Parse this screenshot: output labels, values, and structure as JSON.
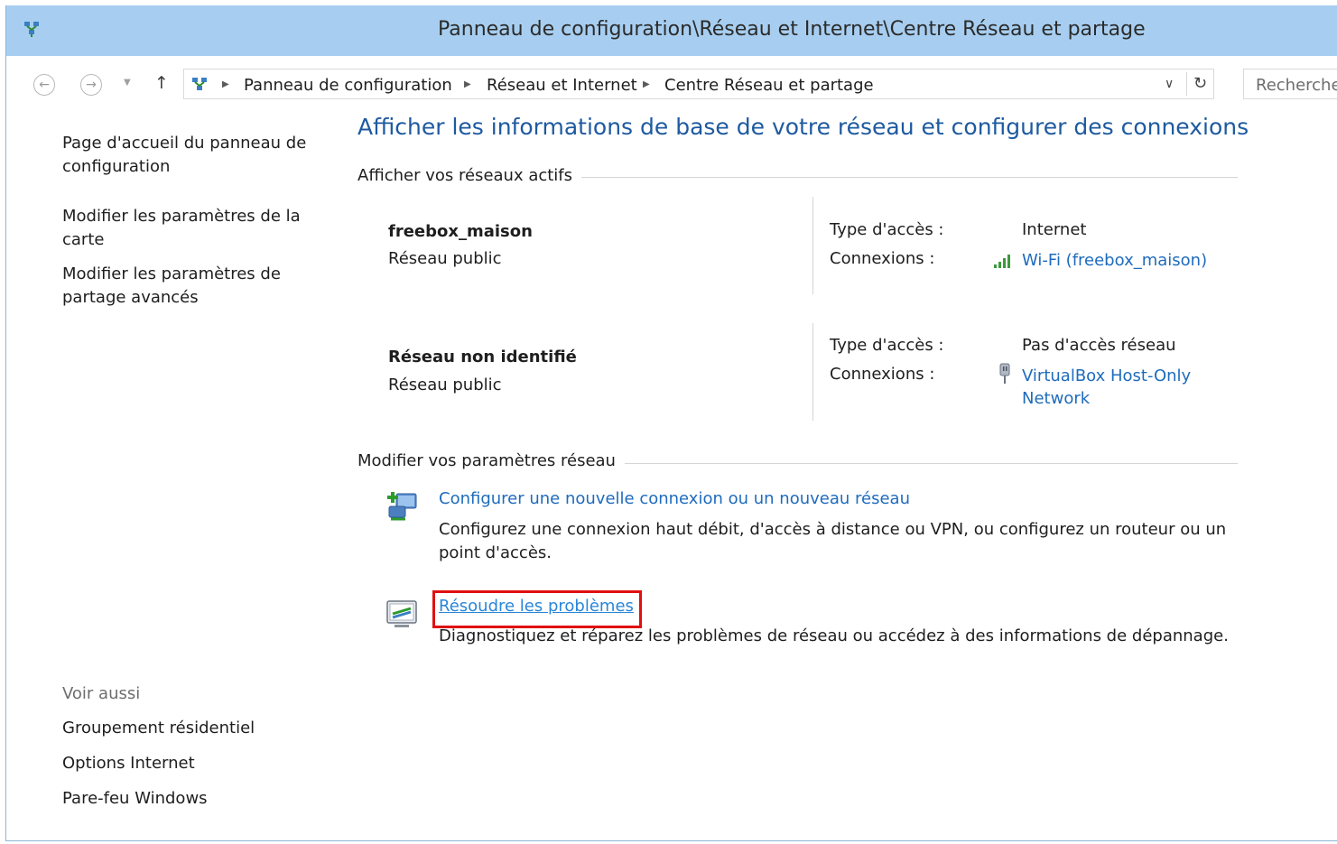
{
  "window": {
    "title": "Panneau de configuration\\Réseau et Internet\\Centre Réseau et partage"
  },
  "address_bar": {
    "back_icon": "back-arrow-icon",
    "forward_icon": "forward-arrow-icon",
    "up_icon": "up-arrow-icon",
    "crumbs": [
      "Panneau de configuration",
      "Réseau et Internet",
      "Centre Réseau et partage"
    ],
    "search_placeholder": "Rechercher"
  },
  "sidebar": {
    "links": [
      "Page d'accueil du panneau de configuration",
      "Modifier les paramètres de la carte",
      "Modifier les paramètres de partage avancés"
    ],
    "see_also_title": "Voir aussi",
    "see_also": [
      "Groupement résidentiel",
      "Options Internet",
      "Pare-feu Windows"
    ]
  },
  "main": {
    "heading": "Afficher les informations de base de votre réseau et configurer des connexions",
    "active_networks_title": "Afficher vos réseaux actifs",
    "networks": [
      {
        "name": "freebox_maison",
        "category": "Réseau public",
        "access_label": "Type d'accès :",
        "access_value": "Internet",
        "connections_label": "Connexions :",
        "connection_link": "Wi-Fi (freebox_maison)",
        "connection_icon": "wifi-signal-icon"
      },
      {
        "name": "Réseau non identifié",
        "category": "Réseau public",
        "access_label": "Type d'accès :",
        "access_value": "Pas d'accès réseau",
        "connections_label": "Connexions :",
        "connection_link_line1": "VirtualBox Host-Only",
        "connection_link_line2": "Network",
        "connection_icon": "ethernet-plug-icon"
      }
    ],
    "change_settings_title": "Modifier vos paramètres réseau",
    "tasks": [
      {
        "link": "Configurer une nouvelle connexion ou un nouveau réseau",
        "desc": "Configurez une connexion haut débit, d'accès à distance ou VPN, ou configurez un routeur ou un point d'accès.",
        "icon": "new-connection-icon"
      },
      {
        "link": "Résoudre les problèmes",
        "desc": "Diagnostiquez et réparez les problèmes de réseau ou accédez à des informations de dépannage.",
        "icon": "troubleshoot-icon"
      }
    ]
  },
  "colors": {
    "titlebar": "#a7cef0",
    "link": "#1e6bbd",
    "heading": "#1e5aa0",
    "highlight": "#e01010"
  }
}
